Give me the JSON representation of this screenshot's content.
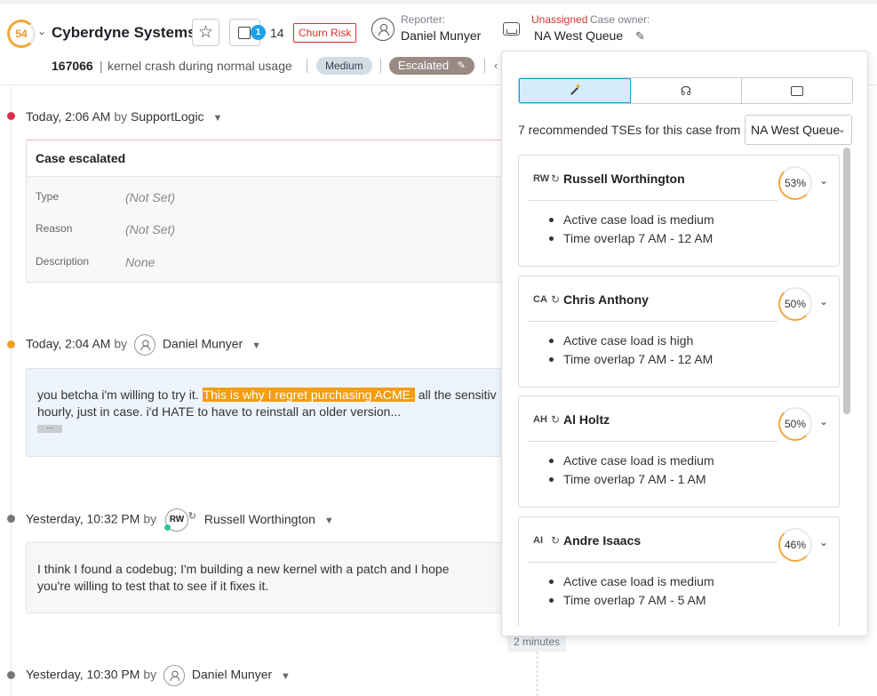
{
  "header": {
    "score": "54",
    "company": "Cyberdyne Systems",
    "cases_badge": "1",
    "cases_count": "14",
    "churn_label": "Churn Risk",
    "reporter_label": "Reporter:",
    "reporter_name": "Daniel Munyer",
    "owner_status": "Unassigned",
    "owner_label": "Case owner:",
    "owner_queue": "NA West Queue",
    "case_number": "167066",
    "case_title": "kernel crash during normal usage",
    "priority": "Medium",
    "status": "Escalated"
  },
  "timeline": {
    "events": [
      {
        "time": "Today, 2:06 AM",
        "by": "by",
        "author": "SupportLogic"
      },
      {
        "time": "Today, 2:04 AM",
        "by": "by",
        "author": "Daniel Munyer"
      },
      {
        "time": "Yesterday, 10:32 PM",
        "by": "by",
        "author": "Russell Worthington",
        "initials": "RW"
      },
      {
        "time": "Yesterday, 10:30 PM",
        "by": "by",
        "author": "Daniel Munyer"
      }
    ],
    "escalation": {
      "title": "Case escalated",
      "type_key": "Type",
      "type_val": "(Not Set)",
      "reason_key": "Reason",
      "reason_val": "(Not Set)",
      "desc_key": "Description",
      "desc_val": "None"
    },
    "message1": {
      "before": "you betcha i'm willing to try it. ",
      "highlight": "This is why I regret purchasing ACME.",
      "after": " all the sensitiv",
      "line2": "hourly, just in case. i'd HATE to have to reinstall an older version...",
      "more": "..."
    },
    "message2": {
      "line1": "I think I found a codebug; I'm building a new kernel with a patch and I hope",
      "line2": "you're willing to test that to see if it fixes it."
    },
    "gap": "2 minutes"
  },
  "popover": {
    "rec_text": "7 recommended TSEs for this case from",
    "queue_select": "NA West Queue",
    "tses": [
      {
        "initials": "RW",
        "name": "Russell Worthington",
        "score": "53%",
        "load": "Active case load is medium",
        "overlap": "Time overlap 7 AM - 12 AM"
      },
      {
        "initials": "CA",
        "name": "Chris Anthony",
        "score": "50%",
        "load": "Active case load is high",
        "overlap": "Time overlap 7 AM - 12 AM"
      },
      {
        "initials": "AH",
        "name": "Al Holtz",
        "score": "50%",
        "load": "Active case load is medium",
        "overlap": "Time overlap 7 AM - 1 AM"
      },
      {
        "initials": "AI",
        "name": "Andre Isaacs",
        "score": "46%",
        "load": "Active case load is medium",
        "overlap": "Time overlap 7 AM - 5 AM"
      }
    ]
  },
  "colors": {
    "accent_blue": "#1f9be4",
    "churn_red": "#d8302e",
    "highlight_orange": "#f29d12",
    "score_orange": "#f2a63a"
  }
}
